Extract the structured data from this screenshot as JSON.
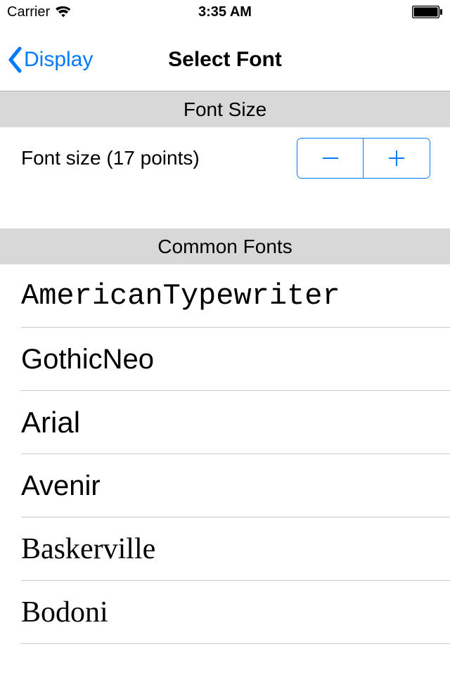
{
  "status_bar": {
    "carrier": "Carrier",
    "time": "3:35 AM"
  },
  "nav": {
    "back_label": "Display",
    "title": "Select Font"
  },
  "sections": {
    "font_size": {
      "header": "Font Size",
      "label": "Font size (17 points)"
    },
    "common_fonts": {
      "header": "Common Fonts",
      "items": [
        "AmericanTypewriter",
        "GothicNeo",
        "Arial",
        "Avenir",
        "Baskerville",
        "Bodoni"
      ]
    }
  }
}
